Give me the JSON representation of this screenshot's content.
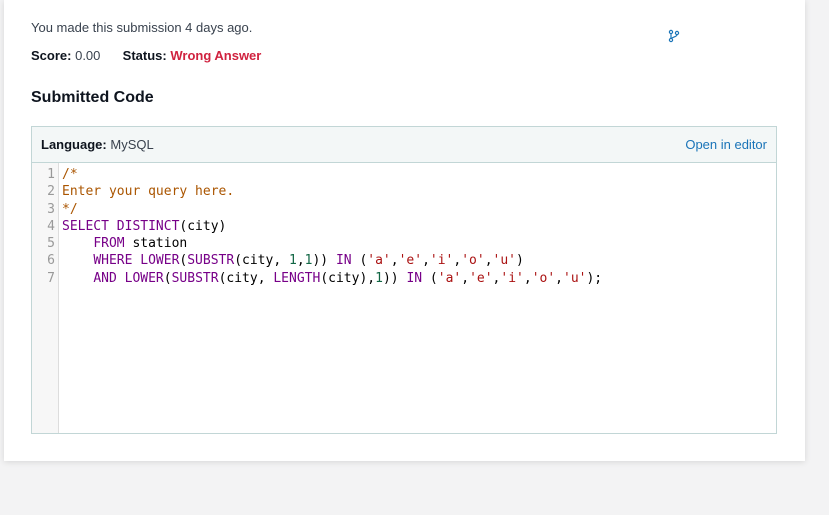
{
  "submission": {
    "made_text": "You made this submission 4 days ago.",
    "score_label": "Score:",
    "score_value": "0.00",
    "status_label": "Status:",
    "status_value": "Wrong Answer",
    "status_color": "#d0223f"
  },
  "section_title": "Submitted Code",
  "code_panel": {
    "language_label": "Language:",
    "language_value": "MySQL",
    "open_in_editor": "Open in editor"
  },
  "icons": {
    "branch": "branch-icon"
  },
  "code": {
    "line_numbers": [
      "1",
      "2",
      "3",
      "4",
      "5",
      "6",
      "7"
    ],
    "lines": [
      [
        {
          "t": "/*",
          "k": "comment"
        }
      ],
      [
        {
          "t": "Enter your query here.",
          "k": "comment"
        }
      ],
      [
        {
          "t": "*/",
          "k": "comment"
        }
      ],
      [
        {
          "t": "SELECT DISTINCT",
          "k": "keyword"
        },
        {
          "t": "(city)",
          "k": "plain"
        }
      ],
      [
        {
          "t": "    ",
          "k": "plain"
        },
        {
          "t": "FROM",
          "k": "keyword"
        },
        {
          "t": " station",
          "k": "plain"
        }
      ],
      [
        {
          "t": "    ",
          "k": "plain"
        },
        {
          "t": "WHERE LOWER",
          "k": "keyword"
        },
        {
          "t": "(",
          "k": "plain"
        },
        {
          "t": "SUBSTR",
          "k": "keyword"
        },
        {
          "t": "(city, ",
          "k": "plain"
        },
        {
          "t": "1",
          "k": "number"
        },
        {
          "t": ",",
          "k": "plain"
        },
        {
          "t": "1",
          "k": "number"
        },
        {
          "t": ")) ",
          "k": "plain"
        },
        {
          "t": "IN",
          "k": "keyword"
        },
        {
          "t": " (",
          "k": "plain"
        },
        {
          "t": "'a'",
          "k": "string"
        },
        {
          "t": ",",
          "k": "plain"
        },
        {
          "t": "'e'",
          "k": "string"
        },
        {
          "t": ",",
          "k": "plain"
        },
        {
          "t": "'i'",
          "k": "string"
        },
        {
          "t": ",",
          "k": "plain"
        },
        {
          "t": "'o'",
          "k": "string"
        },
        {
          "t": ",",
          "k": "plain"
        },
        {
          "t": "'u'",
          "k": "string"
        },
        {
          "t": ")",
          "k": "plain"
        }
      ],
      [
        {
          "t": "    ",
          "k": "plain"
        },
        {
          "t": "AND LOWER",
          "k": "keyword"
        },
        {
          "t": "(",
          "k": "plain"
        },
        {
          "t": "SUBSTR",
          "k": "keyword"
        },
        {
          "t": "(city, ",
          "k": "plain"
        },
        {
          "t": "LENGTH",
          "k": "keyword"
        },
        {
          "t": "(city),",
          "k": "plain"
        },
        {
          "t": "1",
          "k": "number"
        },
        {
          "t": ")) ",
          "k": "plain"
        },
        {
          "t": "IN",
          "k": "keyword"
        },
        {
          "t": " (",
          "k": "plain"
        },
        {
          "t": "'a'",
          "k": "string"
        },
        {
          "t": ",",
          "k": "plain"
        },
        {
          "t": "'e'",
          "k": "string"
        },
        {
          "t": ",",
          "k": "plain"
        },
        {
          "t": "'i'",
          "k": "string"
        },
        {
          "t": ",",
          "k": "plain"
        },
        {
          "t": "'o'",
          "k": "string"
        },
        {
          "t": ",",
          "k": "plain"
        },
        {
          "t": "'u'",
          "k": "string"
        },
        {
          "t": ");",
          "k": "plain"
        }
      ]
    ]
  }
}
